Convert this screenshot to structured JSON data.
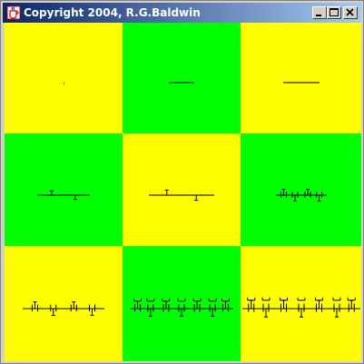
{
  "window": {
    "title": "Copyright 2004, R.G.Baldwin",
    "controls": [
      "minimize",
      "maximize",
      "close"
    ],
    "icons": {
      "app": "java-cup-icon",
      "minimize": "minimize-icon",
      "maximize": "maximize-icon",
      "close": "close-icon"
    }
  },
  "colors": {
    "yellow": "#ffff00",
    "green": "#00ff00",
    "titlebar_start": "#0a246a",
    "titlebar_end": "#a6caf0",
    "frame": "#d4d0c8",
    "ink": "#000000"
  },
  "grid": {
    "rows": 3,
    "cols": 3,
    "pattern": [
      [
        "yellow",
        "green",
        "yellow"
      ],
      [
        "green",
        "yellow",
        "green"
      ],
      [
        "yellow",
        "green",
        "yellow"
      ]
    ],
    "fractal_levels": [
      0,
      1,
      2,
      3,
      4,
      5,
      6,
      7,
      8
    ]
  }
}
